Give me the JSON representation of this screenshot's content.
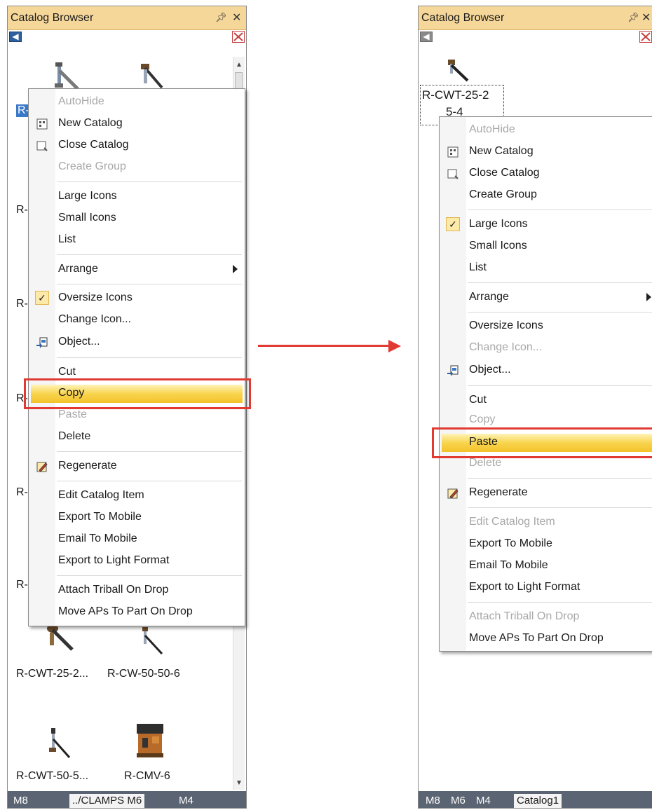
{
  "left_panel": {
    "title": "Catalog Browser",
    "pin_icon": "pin-icon",
    "close_icon": "close-icon",
    "items": [
      {
        "label": "R-"
      },
      {
        "label": "R-"
      },
      {
        "label": "R-"
      },
      {
        "label": "R-"
      },
      {
        "label": "R-"
      },
      {
        "label": "R-"
      },
      {
        "label": "R-CWT-25-2..."
      },
      {
        "label": "R-CW-50-50-6"
      },
      {
        "label": "R-CWT-50-5..."
      },
      {
        "label": "R-CMV-6"
      }
    ],
    "tabs": [
      "M8",
      "../CLAMPS",
      "M6",
      "M4"
    ],
    "active_tab": 2,
    "menu": {
      "autohide": "AutoHide",
      "new_catalog": "New Catalog",
      "close_catalog": "Close Catalog",
      "create_group": "Create Group",
      "large_icons": "Large Icons",
      "small_icons": "Small Icons",
      "list": "List",
      "arrange": "Arrange",
      "oversize_icons": "Oversize Icons",
      "change_icon": "Change Icon...",
      "object": "Object...",
      "cut": "Cut",
      "copy": "Copy",
      "paste": "Paste",
      "delete": "Delete",
      "regenerate": "Regenerate",
      "edit_catalog_item": "Edit Catalog Item",
      "export_to_mobile": "Export To Mobile",
      "email_to_mobile": "Email To Mobile",
      "export_to_light_format": "Export to Light Format",
      "attach_triball": "Attach Triball On Drop",
      "move_aps": "Move APs To Part On Drop"
    }
  },
  "right_panel": {
    "title": "Catalog Browser",
    "item_label_line1": "R-CWT-25-2",
    "item_label_line2": "5-4",
    "tabs": [
      "M8",
      "M6",
      "M4",
      "Catalog1"
    ],
    "active_tab": 3,
    "menu": {
      "autohide": "AutoHide",
      "new_catalog": "New Catalog",
      "close_catalog": "Close Catalog",
      "create_group": "Create Group",
      "large_icons": "Large Icons",
      "small_icons": "Small Icons",
      "list": "List",
      "arrange": "Arrange",
      "oversize_icons": "Oversize Icons",
      "change_icon": "Change Icon...",
      "object": "Object...",
      "cut": "Cut",
      "copy": "Copy",
      "paste": "Paste",
      "delete": "Delete",
      "regenerate": "Regenerate",
      "edit_catalog_item": "Edit Catalog Item",
      "export_to_mobile": "Export To Mobile",
      "email_to_mobile": "Email To Mobile",
      "export_to_light_format": "Export to Light Format",
      "attach_triball": "Attach Triball On Drop",
      "move_aps": "Move APs To Part On Drop"
    }
  },
  "colors": {
    "title_bar": "#f6d79a",
    "highlight": "#f8d44e",
    "annotation_red": "#e03a32",
    "tab_bar": "#5b6472"
  }
}
